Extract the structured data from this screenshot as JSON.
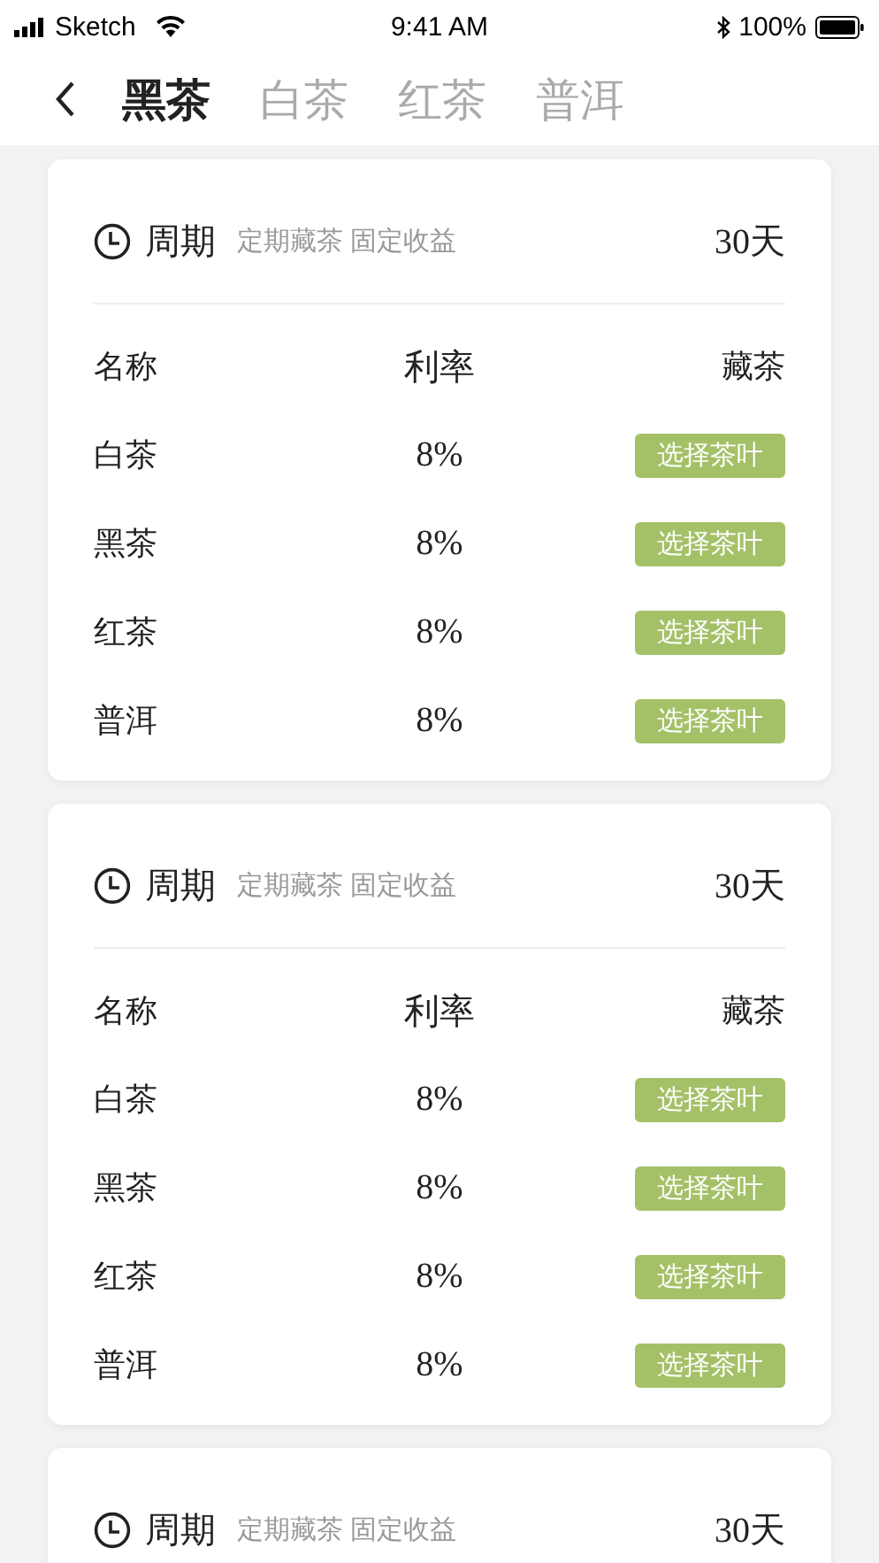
{
  "status_bar": {
    "carrier": "Sketch",
    "time": "9:41 AM",
    "battery": "100%"
  },
  "tabs": [
    {
      "label": "黑茶",
      "selected": true
    },
    {
      "label": "白茶",
      "selected": false
    },
    {
      "label": "红茶",
      "selected": false
    },
    {
      "label": "普洱",
      "selected": false
    }
  ],
  "cards": [
    {
      "title": "周期",
      "subtitle": "定期藏茶 固定收益",
      "duration": "30天",
      "columns": [
        "名称",
        "利率",
        "藏茶"
      ],
      "rows": [
        {
          "name": "白茶",
          "rate": "8%",
          "button": "选择茶叶"
        },
        {
          "name": "黑茶",
          "rate": "8%",
          "button": "选择茶叶"
        },
        {
          "name": "红茶",
          "rate": "8%",
          "button": "选择茶叶"
        },
        {
          "name": "普洱",
          "rate": "8%",
          "button": "选择茶叶"
        }
      ]
    },
    {
      "title": "周期",
      "subtitle": "定期藏茶 固定收益",
      "duration": "30天",
      "columns": [
        "名称",
        "利率",
        "藏茶"
      ],
      "rows": [
        {
          "name": "白茶",
          "rate": "8%",
          "button": "选择茶叶"
        },
        {
          "name": "黑茶",
          "rate": "8%",
          "button": "选择茶叶"
        },
        {
          "name": "红茶",
          "rate": "8%",
          "button": "选择茶叶"
        },
        {
          "name": "普洱",
          "rate": "8%",
          "button": "选择茶叶"
        }
      ]
    },
    {
      "title": "周期",
      "subtitle": "定期藏茶 固定收益",
      "duration": "30天"
    }
  ]
}
